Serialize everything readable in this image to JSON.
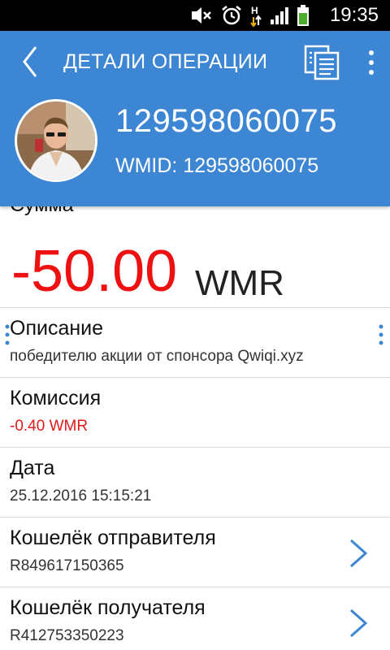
{
  "status_bar": {
    "time": "19:35",
    "icons": [
      "mute-icon",
      "alarm-icon",
      "data-h-icon",
      "signal-icon",
      "battery-icon"
    ],
    "network_label": "H"
  },
  "header": {
    "title": "ДЕТАЛИ ОПЕРАЦИИ",
    "account_number": "129598060075",
    "wmid_label": "WMID: 129598060075",
    "colors": {
      "background": "#3c86d3",
      "text": "#ffffff"
    }
  },
  "amount": {
    "label": "Сумма",
    "value": "-50.00",
    "currency": "WMR",
    "color": "#ee1111"
  },
  "details": [
    {
      "label": "Описание",
      "value": "победителю акции от спонсора Qwiqi.xyz",
      "value_color": "normal",
      "has_chevron": false
    },
    {
      "label": "Комиссия",
      "value": "-0.40 WMR",
      "value_color": "red",
      "has_chevron": false
    },
    {
      "label": "Дата",
      "value": "25.12.2016 15:15:21",
      "value_color": "normal",
      "has_chevron": false
    },
    {
      "label": "Кошелёк отправителя",
      "value": "R849617150365",
      "value_color": "normal",
      "has_chevron": true
    },
    {
      "label": "Кошелёк получателя",
      "value": "R412753350223",
      "value_color": "normal",
      "has_chevron": true
    }
  ]
}
